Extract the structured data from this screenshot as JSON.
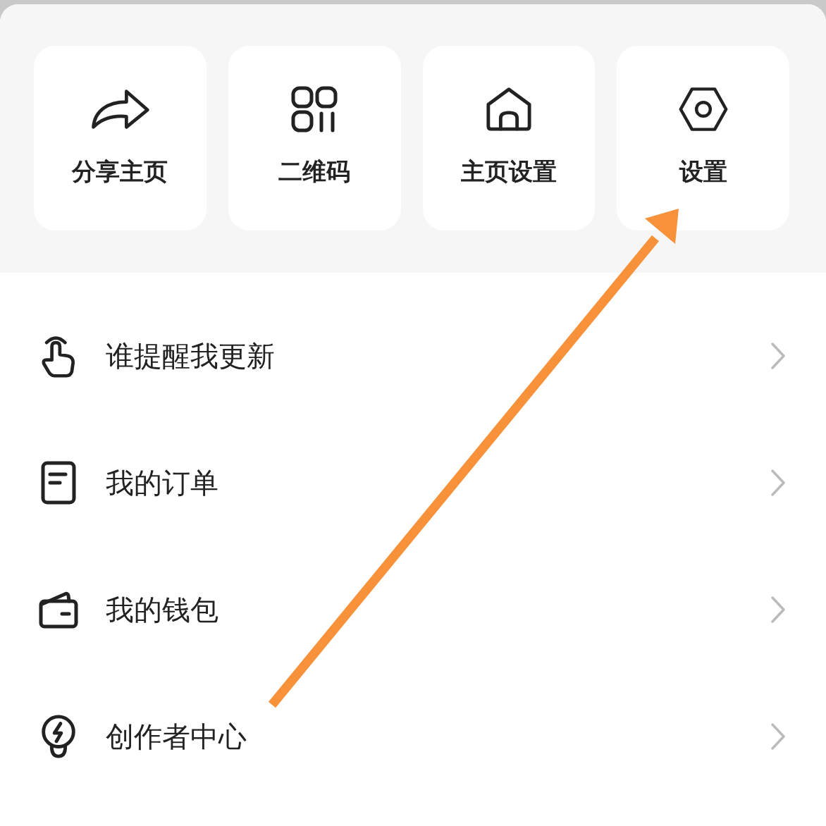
{
  "quick_actions": [
    {
      "label": "分享主页"
    },
    {
      "label": "二维码"
    },
    {
      "label": "主页设置"
    },
    {
      "label": "设置"
    }
  ],
  "menu": [
    {
      "label": "谁提醒我更新"
    },
    {
      "label": "我的订单"
    },
    {
      "label": "我的钱包"
    },
    {
      "label": "创作者中心"
    }
  ]
}
